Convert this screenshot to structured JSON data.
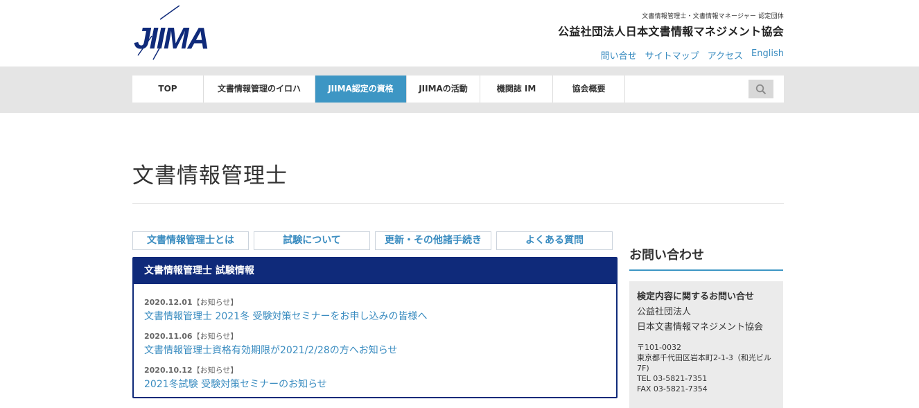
{
  "header": {
    "logo_text": "JIIMA",
    "org_subtitle": "文書情報管理士・文書情報マネージャー 認定団体",
    "org_name": "公益社団法人日本文書情報マネジメント協会",
    "util_links": [
      "問い合せ",
      "サイトマップ",
      "アクセス",
      "English"
    ]
  },
  "nav": {
    "items": [
      "TOP",
      "文書情報管理のイロハ",
      "JIIMA認定の資格",
      "JIIMAの活動",
      "機関誌 IM",
      "協会概要"
    ],
    "active_index": 2,
    "search_icon": "search-icon"
  },
  "page": {
    "title": "文書情報管理士"
  },
  "subtabs": [
    "文書情報管理士とは",
    "試験について",
    "更新・その他諸手続き",
    "よくある質問"
  ],
  "news": {
    "heading": "文書情報管理士 試験情報",
    "entries": [
      {
        "date": "2020.12.01",
        "tag": "【お知らせ】",
        "title": "文書情報管理士 2021冬 受験対策セミナーをお申し込みの皆様へ"
      },
      {
        "date": "2020.11.06",
        "tag": "【お知らせ】",
        "title": "文書情報管理士資格有効期限が2021/2/28の方へお知らせ"
      },
      {
        "date": "2020.10.12",
        "tag": "【お知らせ】",
        "title": "2021冬試験 受験対策セミナーのお知らせ"
      }
    ]
  },
  "sidebar": {
    "title": "お問い合わせ",
    "card_title": "検定内容に関するお問い合せ",
    "org_line1": "公益社団法人",
    "org_line2": "日本文書情報マネジメント協会",
    "postal": "〒101-0032",
    "address": "東京都千代田区岩本町2-1-3（和光ビル7F)",
    "tel": "TEL 03-5821-7351",
    "fax": "FAX 03-5821-7354"
  },
  "colors": {
    "accent": "#3d96c4",
    "navy": "#0f2a7a",
    "link": "#3a8cc0",
    "logo": "#0f2a7a"
  }
}
